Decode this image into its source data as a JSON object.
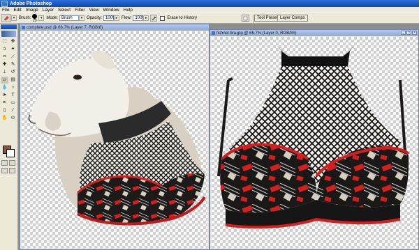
{
  "app": {
    "title": "Adobe Photoshop"
  },
  "menu": [
    "File",
    "Edit",
    "Image",
    "Layer",
    "Select",
    "Filter",
    "View",
    "Window",
    "Help"
  ],
  "options": {
    "brush_label": "Brush:",
    "brush_size": "29",
    "mode_label": "Mode:",
    "mode_value": "Brush",
    "opacity_label": "Opacity:",
    "opacity_value": "100%",
    "flow_label": "Flow:",
    "flow_value": "100%",
    "erase_history_label": "Erase to History"
  },
  "palette_well": {
    "tool_presets": "Tool Presets",
    "layer_comps": "Layer Comps"
  },
  "documents": [
    {
      "title": "complete.psd @ 66.7% (Layer 7, RGB/8)"
    },
    {
      "title": "fishnet bra.jpg @ 66.7% (Layer 0, RGB/8#)"
    }
  ],
  "tools": [
    "marquee-icon",
    "move-icon",
    "lasso-icon",
    "magic-wand-icon",
    "crop-icon",
    "slice-icon",
    "healing-icon",
    "brush-icon",
    "stamp-icon",
    "history-brush-icon",
    "eraser-icon",
    "gradient-icon",
    "blur-icon",
    "dodge-icon",
    "path-select-icon",
    "type-icon",
    "pen-icon",
    "shape-icon",
    "notes-icon",
    "eyedropper-icon",
    "hand-icon",
    "zoom-icon"
  ],
  "colors": {
    "foreground": "#8b5a2b",
    "background": "#ffffff",
    "accent": "#0b48b8"
  }
}
